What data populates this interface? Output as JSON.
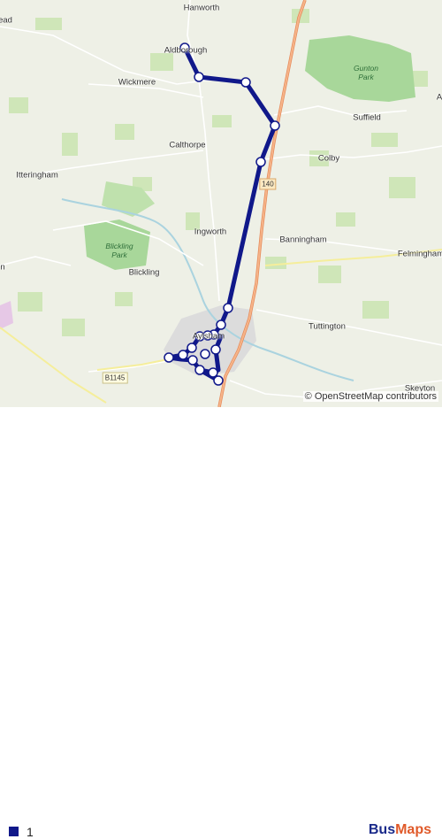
{
  "map": {
    "places": [
      {
        "key": "hanworth",
        "text": "Hanworth"
      },
      {
        "key": "ead",
        "text": "ead"
      },
      {
        "key": "aldborough",
        "text": "Aldborough"
      },
      {
        "key": "wickmere",
        "text": "Wickmere"
      },
      {
        "key": "suffield",
        "text": "Suffield"
      },
      {
        "key": "calthorpe",
        "text": "Calthorpe"
      },
      {
        "key": "colby",
        "text": "Colby"
      },
      {
        "key": "itteringham",
        "text": "Itteringham"
      },
      {
        "key": "ingworth",
        "text": "Ingworth"
      },
      {
        "key": "banningham",
        "text": "Banningham"
      },
      {
        "key": "felmingham",
        "text": "Felmingham"
      },
      {
        "key": "blickling",
        "text": "Blickling"
      },
      {
        "key": "tuttington",
        "text": "Tuttington"
      },
      {
        "key": "aylsham",
        "text": "Aylsham"
      },
      {
        "key": "skeyton",
        "text": "Skeyton"
      },
      {
        "key": "a_edge",
        "text": "A"
      },
      {
        "key": "n_edge",
        "text": "n"
      }
    ],
    "parks": {
      "gunton": {
        "line1": "Gunton",
        "line2": "Park"
      },
      "blickling": {
        "line1": "Blickling",
        "line2": "Park"
      }
    },
    "roads": {
      "a140": "140",
      "b1145": "B1145"
    },
    "route": {
      "color": "#10188a",
      "stop_count": 19
    },
    "attribution": "© OpenStreetMap contributors"
  },
  "legend": {
    "route_name": "1",
    "color": "#10188a"
  },
  "brand": {
    "part1": "Bus",
    "part2": "Maps"
  }
}
